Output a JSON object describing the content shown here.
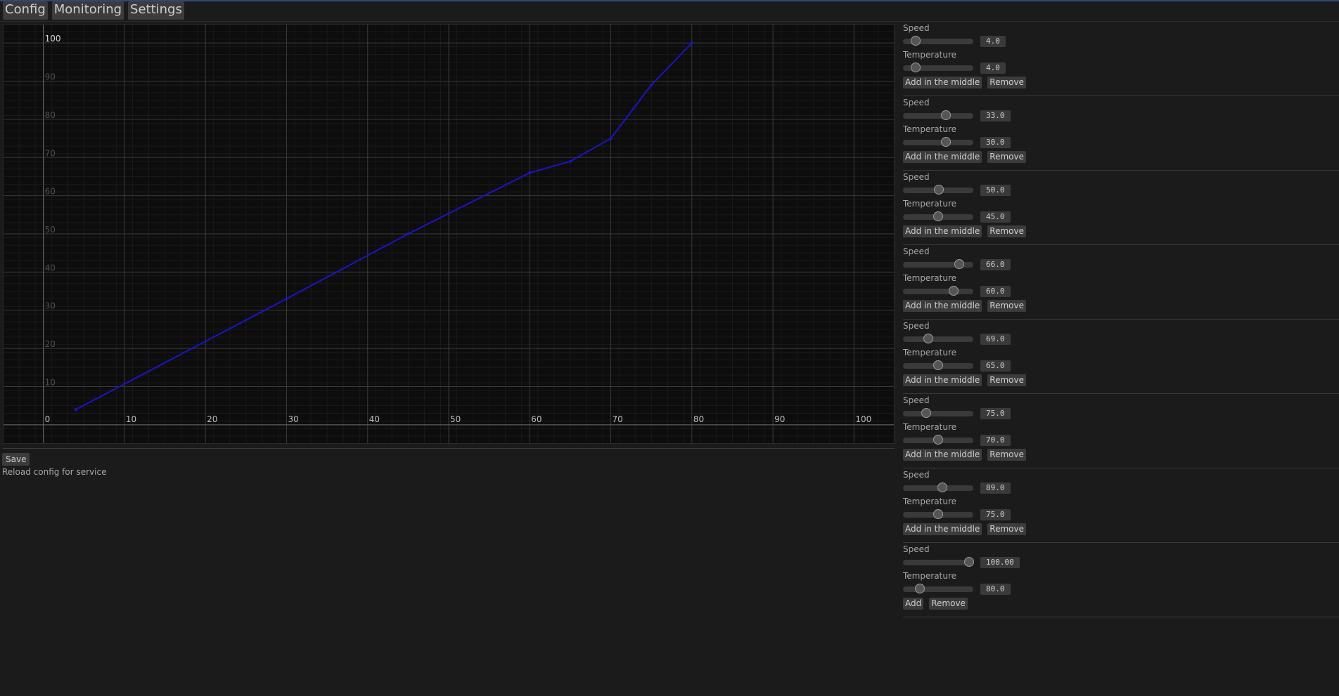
{
  "tabs": [
    "Config",
    "Monitoring",
    "Settings"
  ],
  "chart_data": {
    "type": "line",
    "xlim": [
      -5,
      105
    ],
    "ylim": [
      -5,
      105
    ],
    "x_ticks": [
      "0",
      "10",
      "20",
      "30",
      "40",
      "50",
      "60",
      "70",
      "80",
      "90",
      "100"
    ],
    "y_ticks": [
      "0",
      "10",
      "20",
      "30",
      "40",
      "50",
      "60",
      "70",
      "80",
      "90",
      "100"
    ],
    "series": [
      {
        "color": "#1a14c8",
        "x": [
          4,
          30,
          45,
          60,
          65,
          70,
          75,
          80
        ],
        "y": [
          4,
          33,
          50,
          66,
          69,
          75,
          89,
          100
        ]
      }
    ],
    "grid": true,
    "colors": {
      "background": "#0d0d0d",
      "grid_major": "#3a3a3a",
      "grid_minor": "#1a1a1a"
    }
  },
  "save_label": "Save",
  "reload_text": "Reload config for service",
  "labels": {
    "speed": "Speed",
    "temperature": "Temperature"
  },
  "points": [
    {
      "speed": "4.0",
      "temperature": "4.0",
      "speed_level": 0.18,
      "temp_level": 0.18,
      "add_label": "Add in the middle",
      "remove_label": "Remove"
    },
    {
      "speed": "33.0",
      "temperature": "30.0",
      "speed_level": 0.61,
      "temp_level": 0.61,
      "add_label": "Add in the middle",
      "remove_label": "Remove"
    },
    {
      "speed": "50.0",
      "temperature": "45.0",
      "speed_level": 0.51,
      "temp_level": 0.5,
      "add_label": "Add in the middle",
      "remove_label": "Remove"
    },
    {
      "speed": "66.0",
      "temperature": "60.0",
      "speed_level": 0.8,
      "temp_level": 0.72,
      "add_label": "Add in the middle",
      "remove_label": "Remove"
    },
    {
      "speed": "69.0",
      "temperature": "65.0",
      "speed_level": 0.36,
      "temp_level": 0.5,
      "add_label": "Add in the middle",
      "remove_label": "Remove"
    },
    {
      "speed": "75.0",
      "temperature": "70.0",
      "speed_level": 0.33,
      "temp_level": 0.5,
      "add_label": "Add in the middle",
      "remove_label": "Remove"
    },
    {
      "speed": "89.0",
      "temperature": "75.0",
      "speed_level": 0.56,
      "temp_level": 0.5,
      "add_label": "Add in the middle",
      "remove_label": "Remove"
    },
    {
      "speed": "100.00",
      "temperature": "80.0",
      "speed_level": 0.94,
      "temp_level": 0.24,
      "add_label": "Add",
      "remove_label": "Remove"
    }
  ]
}
